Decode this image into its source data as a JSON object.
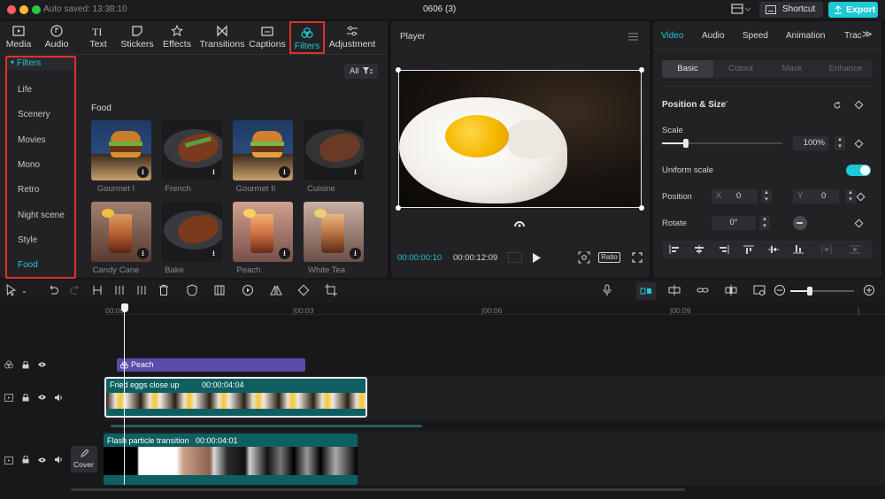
{
  "titlebar": {
    "autosave": "Auto saved: 13:38:10",
    "project": "0606 (3)",
    "shortcut": "Shortcut",
    "export": "Export"
  },
  "toolbar_tabs": [
    {
      "label": "Media",
      "icon": "media-icon"
    },
    {
      "label": "Audio",
      "icon": "audio-icon"
    },
    {
      "label": "Text",
      "icon": "text-icon"
    },
    {
      "label": "Stickers",
      "icon": "stickers-icon"
    },
    {
      "label": "Effects",
      "icon": "effects-icon"
    },
    {
      "label": "Transitions",
      "icon": "transitions-icon"
    },
    {
      "label": "Captions",
      "icon": "captions-icon"
    },
    {
      "label": "Filters",
      "icon": "filters-icon",
      "active": true
    },
    {
      "label": "Adjustment",
      "icon": "adjustment-icon"
    }
  ],
  "filters_sidebar": {
    "header": "Filters",
    "items": [
      "Life",
      "Scenery",
      "Movies",
      "Mono",
      "Retro",
      "Night scene",
      "Style",
      "Food"
    ],
    "selected": "Food"
  },
  "filters_grid": {
    "all_button": "All",
    "section": "Food",
    "items": [
      "Gourmet I",
      "French",
      "Gourmet II",
      "Cuisine",
      "Candy Cane",
      "Bake",
      "Peach",
      "White Tea"
    ]
  },
  "player": {
    "title": "Player",
    "current_time": "00:00:00:10",
    "total_time": "00:00:12:09",
    "ratio": "Ratio"
  },
  "properties": {
    "tabs": [
      "Video",
      "Audio",
      "Speed",
      "Animation",
      "Tracking"
    ],
    "active_tab": "Video",
    "subtabs": [
      "Basic",
      "Cutout",
      "Mask",
      "Enhance"
    ],
    "active_subtab": "Basic",
    "section_title": "Position & Size",
    "scale_label": "Scale",
    "scale_value": "100%",
    "scale_fraction": 0.2,
    "uniform_label": "Uniform scale",
    "uniform_on": true,
    "position_label": "Position",
    "x_label": "X",
    "x_value": "0",
    "y_label": "Y",
    "y_value": "0",
    "rotate_label": "Rotate",
    "rotate_value": "0°"
  },
  "timeline": {
    "ruler": [
      "00:00",
      "|00:03",
      "|00:06",
      "|00:09"
    ],
    "filter_clip": "Peach",
    "video_clip_name": "Fried eggs close up",
    "video_clip_duration": "00:00:04:04",
    "main_clip_name": "Flash particle transition",
    "main_clip_duration": "00:00:04:01",
    "cover_label": "Cover"
  },
  "colors": {
    "accent": "#1fc8d5",
    "highlight": "#e0302a",
    "filter_clip": "#5b4aa8",
    "video_clip": "#0e5f62"
  }
}
